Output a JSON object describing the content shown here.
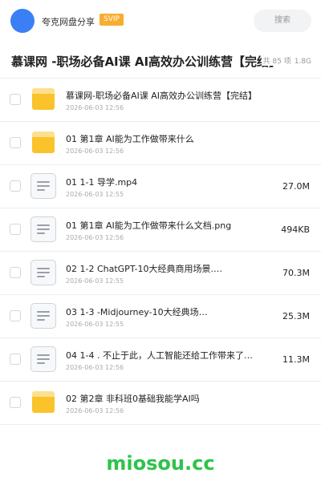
{
  "header": {
    "brand": "夸克网盘分享",
    "badge": "SVIP",
    "search_placeholder": "搜索"
  },
  "folder": {
    "title": "慕课网 -职场必备AI课 AI高效办公训练营【完结】",
    "count_label": "共 85 项",
    "total_size": "1.8G"
  },
  "files": [
    {
      "type": "folder",
      "name": "慕课网-职场必备AI课 AI高效办公训练营【完结】",
      "date": "2026-06-03 12:56",
      "size": ""
    },
    {
      "type": "folder",
      "name": "01 第1章 AI能为工作做带来什么",
      "date": "2026-06-03 12:56",
      "size": ""
    },
    {
      "type": "file",
      "name": "01 1-1 导学.mp4",
      "date": "2026-06-03 12:55",
      "size": "27.0M"
    },
    {
      "type": "file",
      "name": "01 第1章 AI能为工作做带来什么文档.png",
      "date": "2026-06-03 12:56",
      "size": "494KB"
    },
    {
      "type": "file",
      "name": "02 1-2 ChatGPT-10大经典商用场景.…",
      "date": "2026-06-03 12:55",
      "size": "70.3M"
    },
    {
      "type": "file",
      "name": "03 1-3 -Midjourney-10大经典场…",
      "date": "2026-06-03 12:55",
      "size": "25.3M"
    },
    {
      "type": "file",
      "name": "04 1-4 . 不止于此，人工智能还给工作带来了…",
      "date": "2026-06-03 12:56",
      "size": "11.3M"
    },
    {
      "type": "folder",
      "name": "02 第2章 非科班0基础我能学AI吗",
      "date": "2026-06-03 12:56",
      "size": ""
    }
  ],
  "watermark": "miosou.cc",
  "colors": {
    "accent": "#3b7ff5",
    "badge": "#f8ad31",
    "folder": "#fbc32b",
    "watermark": "#2ec34b"
  }
}
